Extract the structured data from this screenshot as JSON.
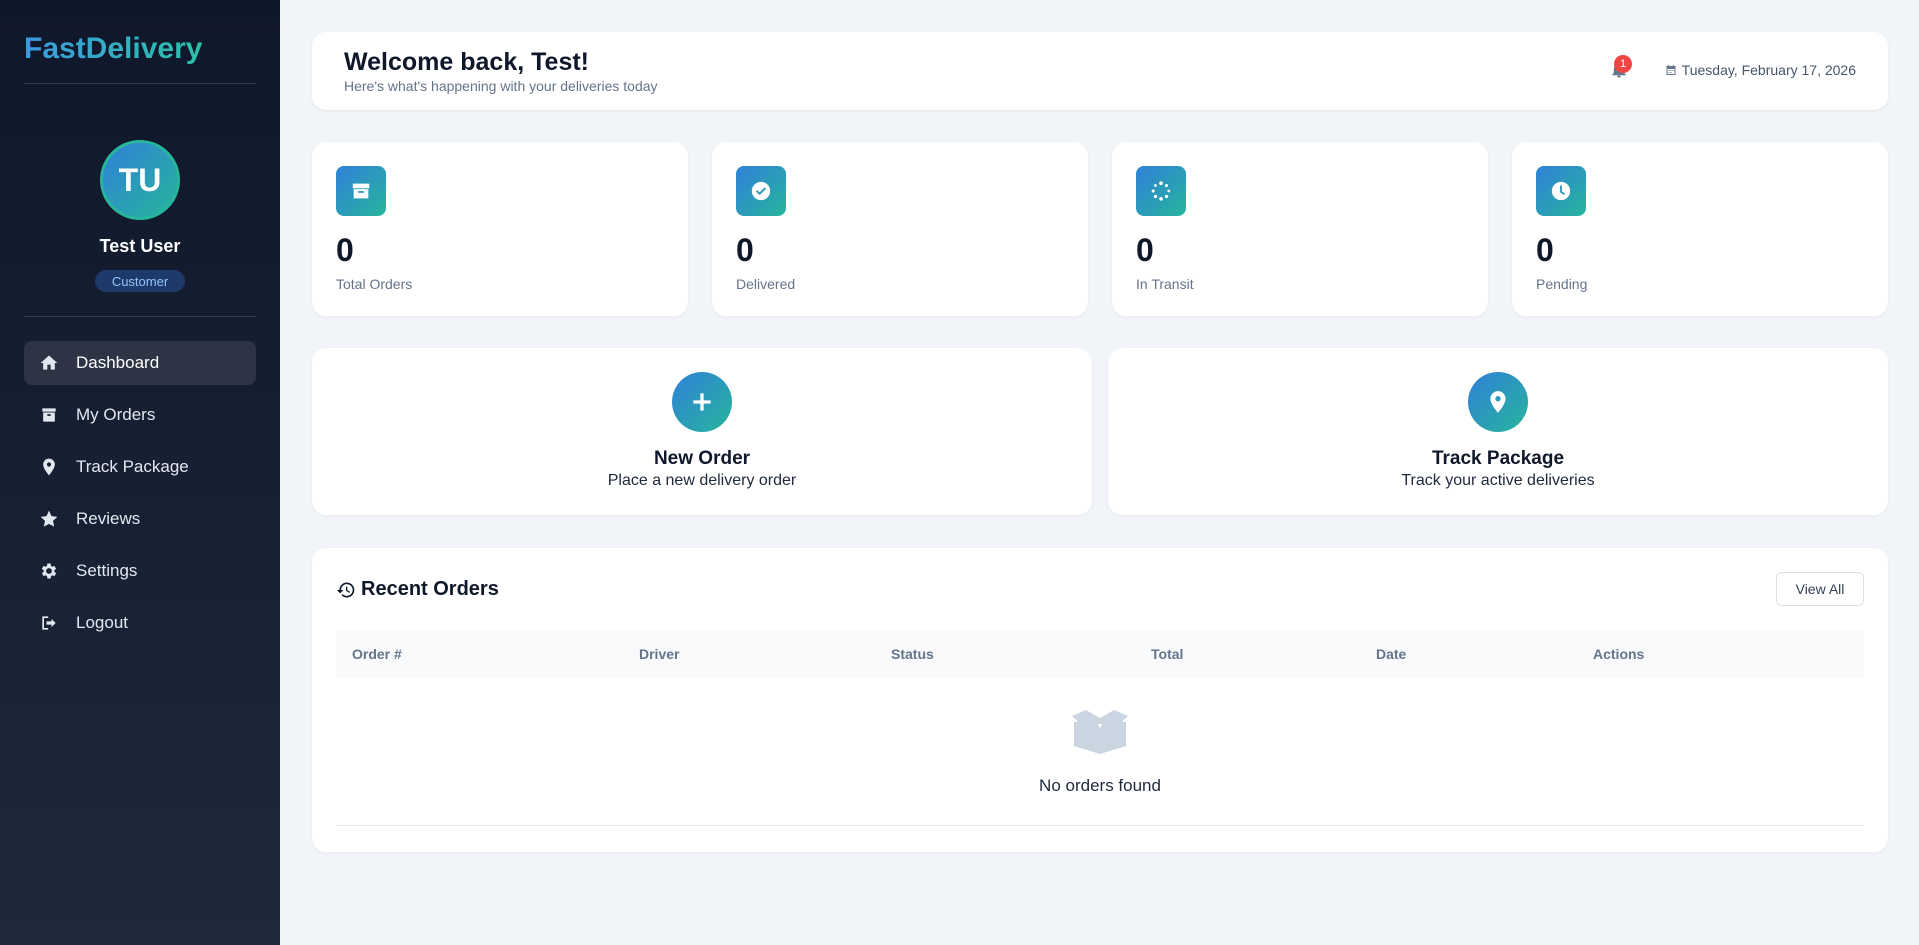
{
  "sidebar": {
    "brand": "FastDelivery",
    "user": {
      "initials": "TU",
      "name": "Test User",
      "role": "Customer"
    },
    "items": [
      {
        "label": "Dashboard",
        "icon": "home-icon",
        "active": true
      },
      {
        "label": "My Orders",
        "icon": "box-icon"
      },
      {
        "label": "Track Package",
        "icon": "map-pin-icon"
      },
      {
        "label": "Reviews",
        "icon": "star-icon"
      },
      {
        "label": "Settings",
        "icon": "gear-icon"
      },
      {
        "label": "Logout",
        "icon": "logout-icon"
      }
    ]
  },
  "header": {
    "title": "Welcome back, Test!",
    "subtitle": "Here's what's happening with your deliveries today",
    "notifications": "1",
    "date": "Tuesday, February 17, 2026"
  },
  "stats": [
    {
      "value": "0",
      "label": "Total Orders",
      "icon": "box-icon"
    },
    {
      "value": "0",
      "label": "Delivered",
      "icon": "check-circle-icon"
    },
    {
      "value": "0",
      "label": "In Transit",
      "icon": "spinner-icon"
    },
    {
      "value": "0",
      "label": "Pending",
      "icon": "clock-icon"
    }
  ],
  "actions": [
    {
      "title": "New Order",
      "subtitle": "Place a new delivery order",
      "icon": "plus-icon"
    },
    {
      "title": "Track Package",
      "subtitle": "Track your active deliveries",
      "icon": "map-pin-icon"
    }
  ],
  "orders": {
    "title": "Recent Orders",
    "view_all": "View All",
    "columns": [
      "Order #",
      "Driver",
      "Status",
      "Total",
      "Date",
      "Actions"
    ],
    "empty_text": "No orders found"
  },
  "colors": {
    "accent_start": "#2f80d9",
    "accent_end": "#27b59b",
    "sidebar_bg": "#0f172a",
    "badge_red": "#ef4444"
  }
}
